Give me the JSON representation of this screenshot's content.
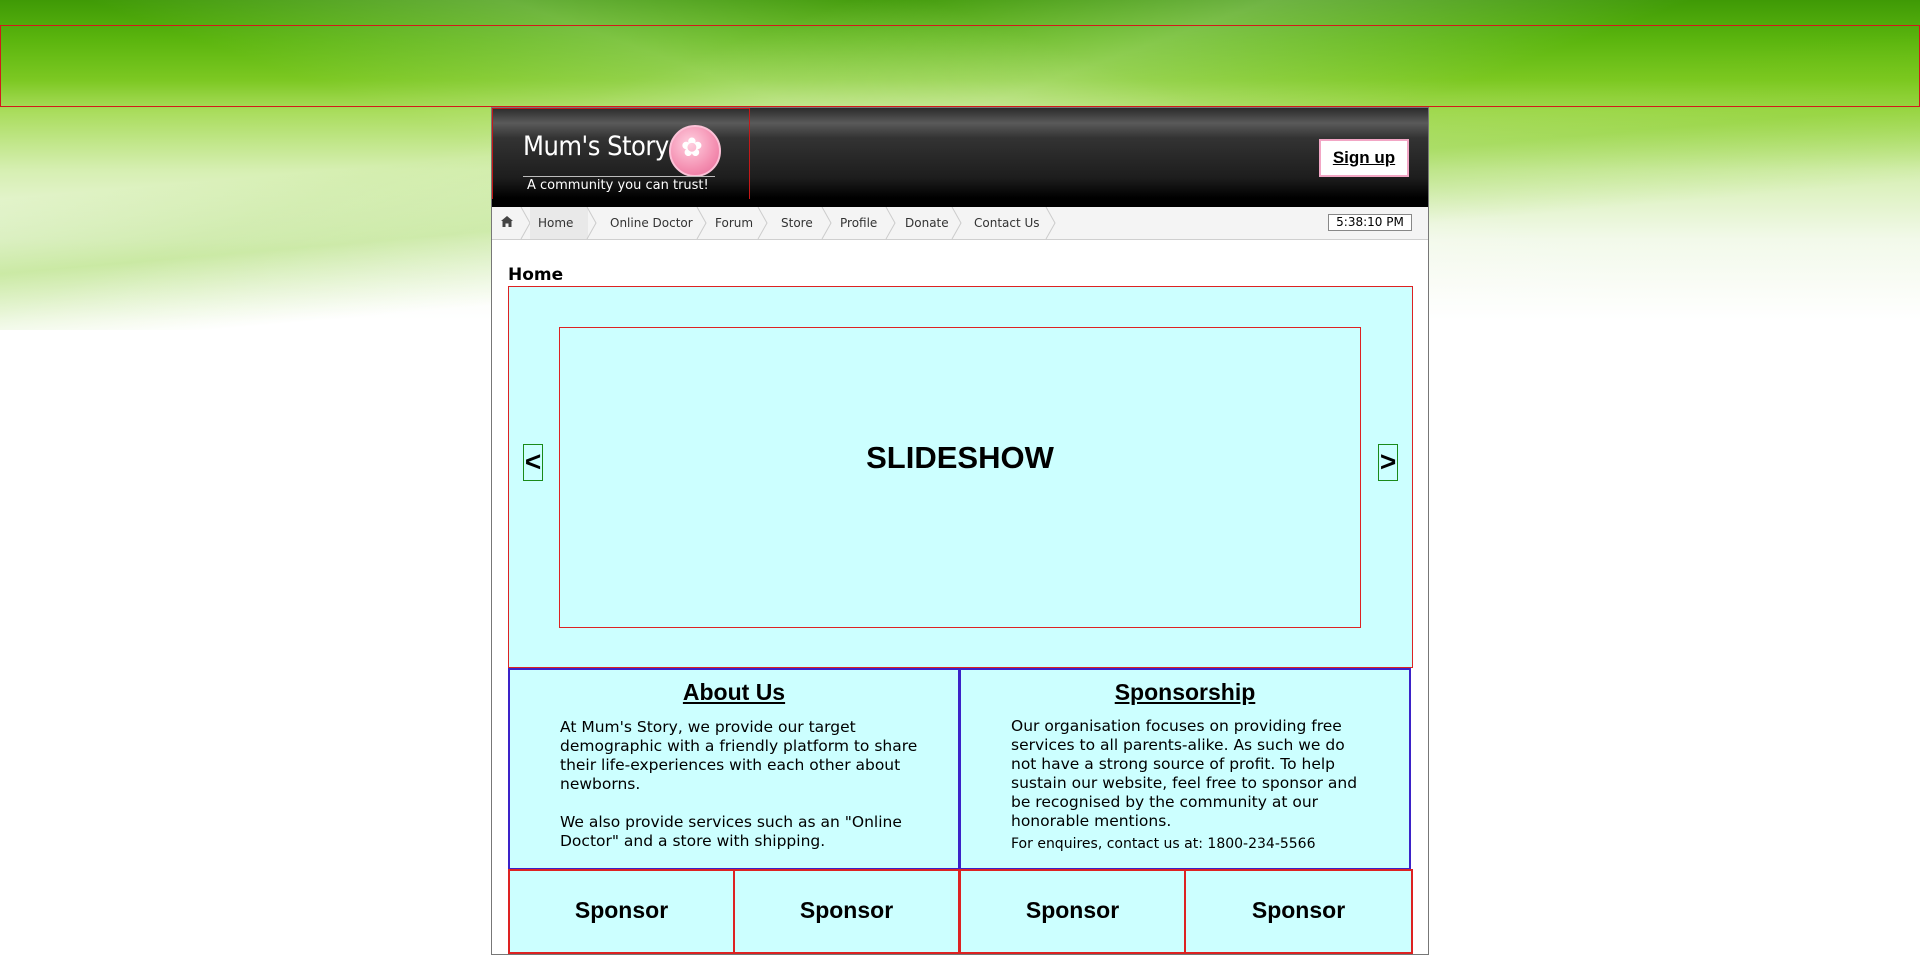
{
  "site": {
    "title": "Mum's Story",
    "tagline": "A community you can trust!",
    "signup_label": "Sign up"
  },
  "nav": {
    "home_icon": "home-icon",
    "items": [
      "Home",
      "Online Doctor",
      "Forum",
      "Store",
      "Profile",
      "Donate",
      "Contact Us"
    ],
    "clock": "5:38:10 PM"
  },
  "page": {
    "heading": "Home"
  },
  "slideshow": {
    "label": "SLIDESHOW",
    "prev": "<",
    "next": ">"
  },
  "about": {
    "title": "About Us",
    "para1": "At Mum's Story, we provide our target demographic with a friendly platform to share their life-experiences with each other about newborns.",
    "para2": "We also provide services such as an \"Online Doctor\" and a store with shipping."
  },
  "sponsorship": {
    "title": "Sponsorship",
    "para1": "Our organisation focuses on providing free services to all parents-alike. As such we do not have a strong source of profit. To help sustain our website, feel free to sponsor and be recognised by the community at our honorable mentions.",
    "contact": "For enquires, contact us at: 1800-234-5566"
  },
  "sponsors": [
    "Sponsor",
    "Sponsor",
    "Sponsor",
    "Sponsor"
  ],
  "colors": {
    "panel_bg": "#ccffff",
    "outline_red": "#dd2222",
    "outline_blue": "#3b22c8",
    "banner_green": "#5bb50e"
  }
}
